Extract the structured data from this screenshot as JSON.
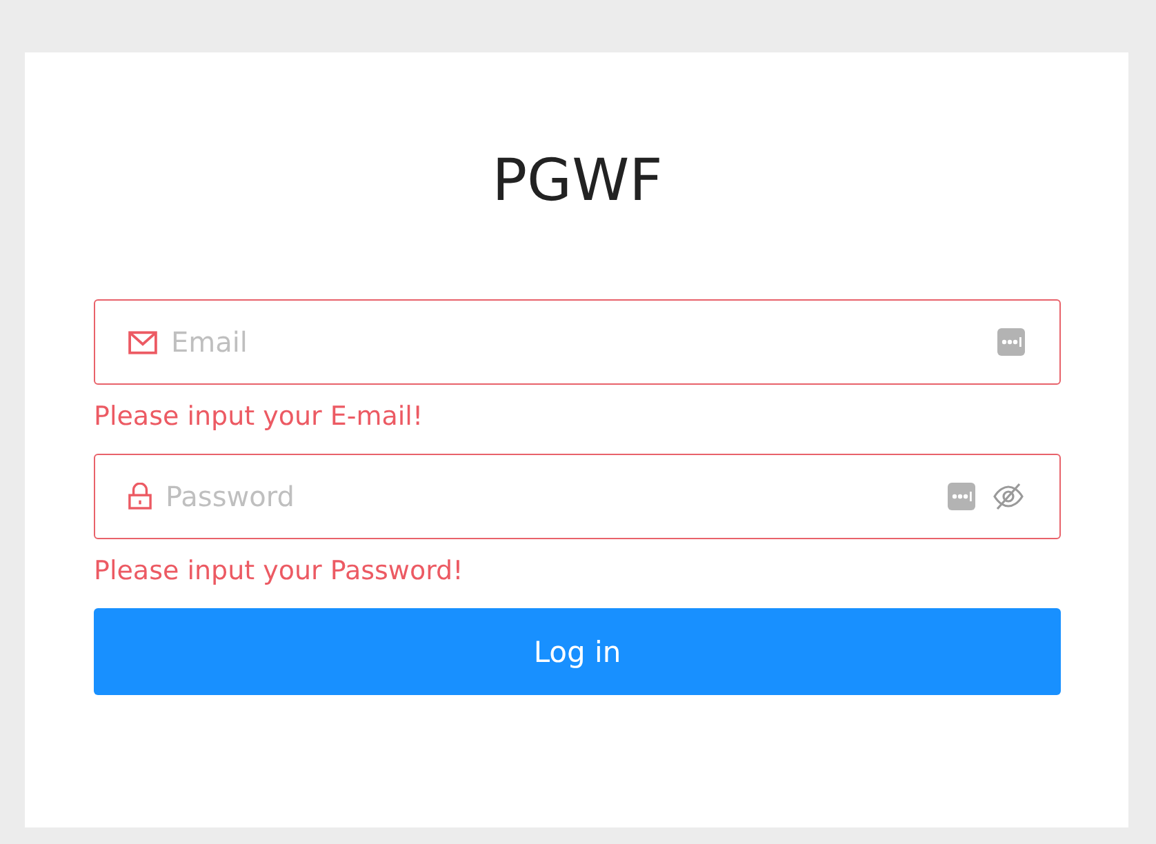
{
  "title": "PGWF",
  "fields": [
    {
      "kind": "email",
      "placeholder": "Email",
      "error": "Please input your E-mail!",
      "reveal_toggle": false
    },
    {
      "kind": "password",
      "placeholder": "Password",
      "error": "Please input your Password!",
      "reveal_toggle": true
    }
  ],
  "submit": {
    "label": "Log in"
  }
}
